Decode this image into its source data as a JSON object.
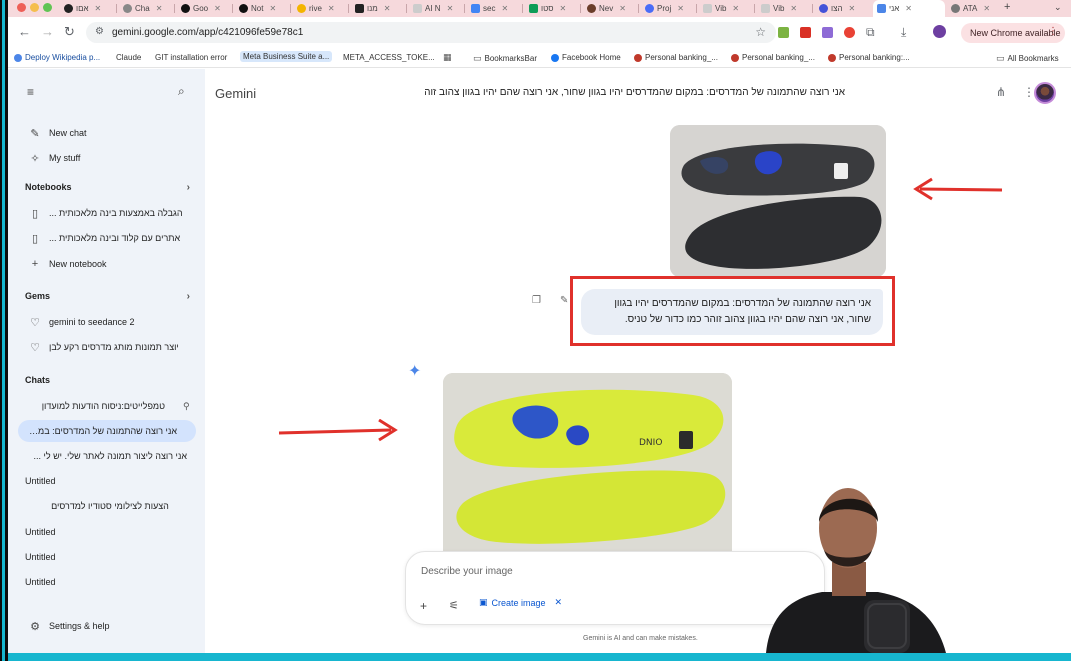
{
  "tabs": [
    {
      "label": "אםו"
    },
    {
      "label": "Cha"
    },
    {
      "label": "Goo"
    },
    {
      "label": "Not"
    },
    {
      "label": "rive"
    },
    {
      "label": "מנו"
    },
    {
      "label": "AI N"
    },
    {
      "label": "sec"
    },
    {
      "label": "סטו"
    },
    {
      "label": "Nev"
    },
    {
      "label": "Proj"
    },
    {
      "label": "Vib"
    },
    {
      "label": "Vib"
    },
    {
      "label": "הצו"
    },
    {
      "label": "אני"
    },
    {
      "label": "ATA"
    }
  ],
  "toolbar": {
    "url": "gemini.google.com/app/c421096fe59e78c1",
    "update_label": "New Chrome available"
  },
  "bookmarks": [
    {
      "label": "Deploy Wikipedia p..."
    },
    {
      "label": "Claude"
    },
    {
      "label": "GIT installation error"
    },
    {
      "label": "Meta Business Suite a..."
    },
    {
      "label": "META_ACCESS_TOKE..."
    },
    {
      "label": "BookmarksBar"
    },
    {
      "label": "Facebook  Home"
    },
    {
      "label": "Personal banking_..."
    },
    {
      "label": "Personal banking_..."
    },
    {
      "label": "Personal banking:..."
    },
    {
      "label": "All Bookmarks"
    }
  ],
  "sidebar": {
    "new_chat": "New chat",
    "my_stuff": "My stuff",
    "notebooks_heading": "Notebooks",
    "notebooks": [
      {
        "label": "הגבלה באמצעות בינה מלאכותית ..."
      },
      {
        "label": "אתרים עם קלוד ובינה מלאכותית ..."
      }
    ],
    "new_notebook": "New notebook",
    "gems_heading": "Gems",
    "gems": [
      {
        "label": "gemini to seedance 2"
      },
      {
        "label": "יוצר תמונות מותג מדרסים רקע לבן"
      }
    ],
    "chats_heading": "Chats",
    "chats": [
      {
        "label": "טמפלייטים:ניסוח הודעות למועדון"
      },
      {
        "label": "אני רוצה שהתמונה של המדרסים: במקו..."
      },
      {
        "label": "אני רוצה ליצור תמונה לאתר שלי. יש לי ..."
      },
      {
        "label": "Untitled"
      },
      {
        "label": "הצעות לצילומי סטודיו למדרסים"
      },
      {
        "label": "Untitled"
      },
      {
        "label": "Untitled"
      },
      {
        "label": "Untitled"
      }
    ],
    "settings": "Settings & help"
  },
  "main": {
    "app_title": "Gemini",
    "conversation_title": "אני רוצה שהתמונה של המדרסים: במקום שהמדרסים יהיו בגוון שחור, אני רוצה שהם יהיו בגוון צהוב זוהר כמ",
    "user_message_line1": "אני רוצה שהתמונה של המדרסים: במקום שהמדרסים יהיו בגוון",
    "user_message_line2": "שחור, אני רוצה שהם יהיו בגוון צהוב זוהר כמו כדור של טניס.",
    "input_placeholder": "Describe your image",
    "create_image_label": "Create image",
    "disclaimer": "Gemini is AI and can make mistakes."
  },
  "colors": {
    "annotation_red": "#e0312b",
    "sidebar_bg": "#eff3f9",
    "accent_blue": "#0b57d0",
    "frame_cyan": "#17b6cf"
  }
}
